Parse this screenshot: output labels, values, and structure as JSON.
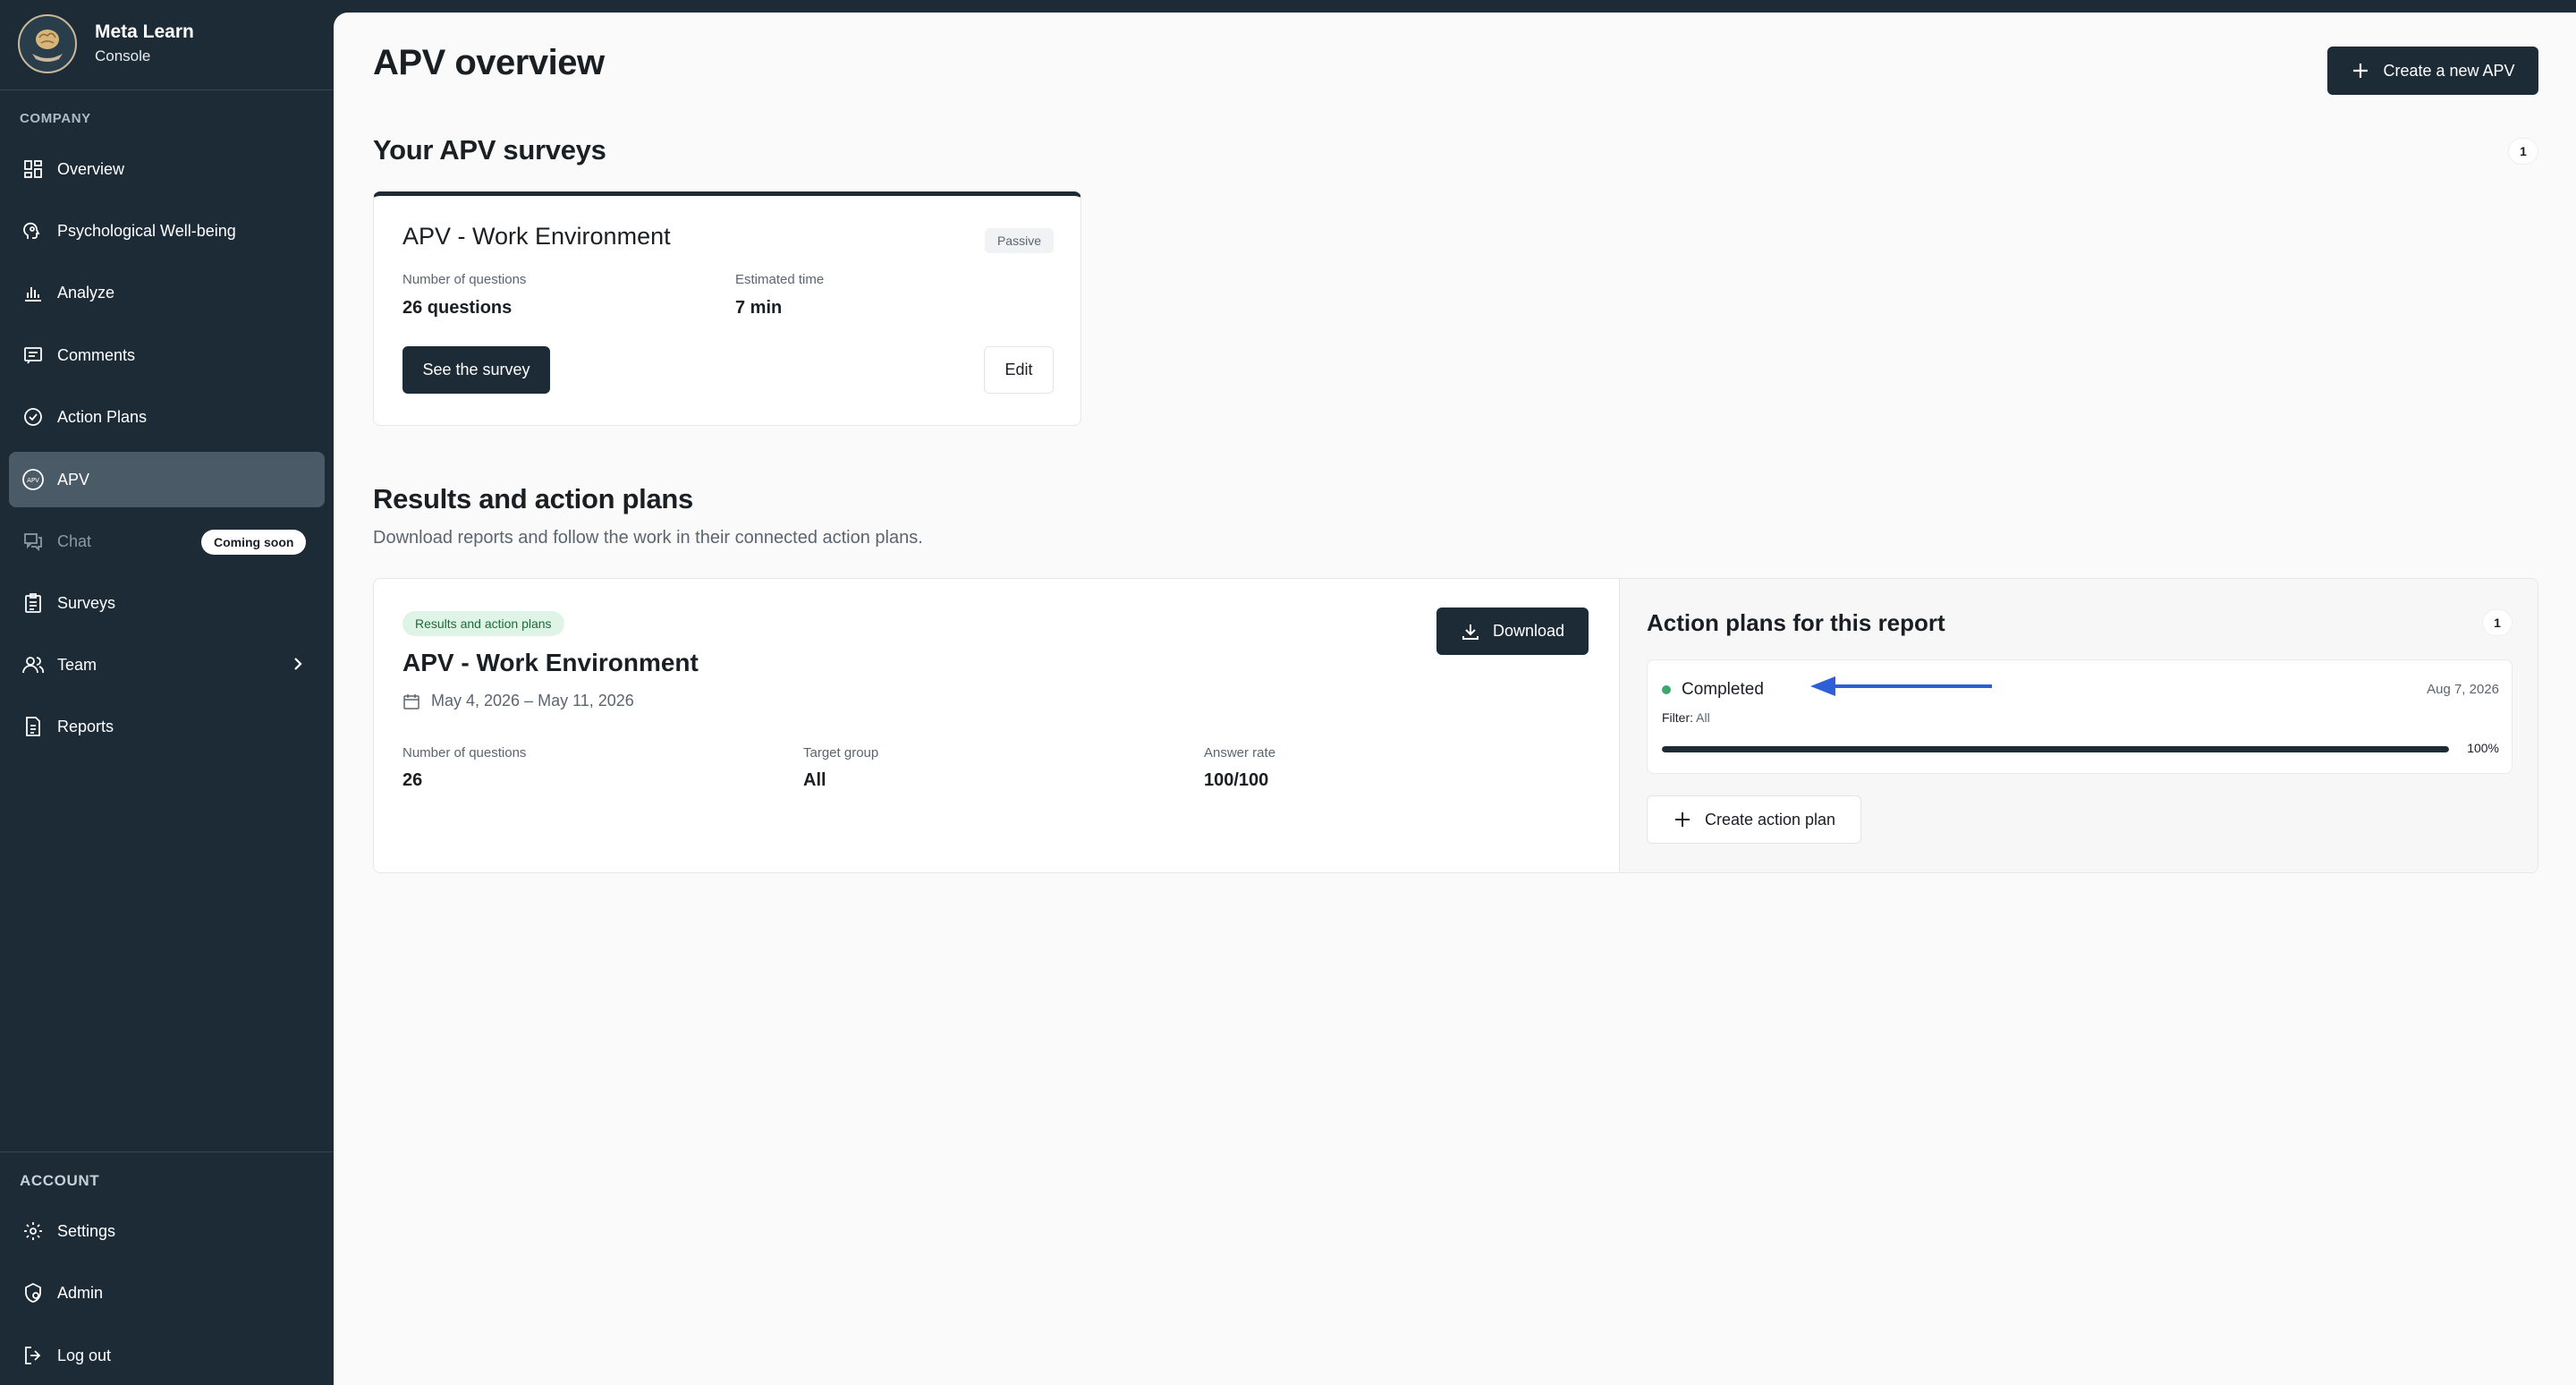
{
  "brand": {
    "name": "Meta Learn",
    "subtitle": "Console"
  },
  "sidebar": {
    "company_label": "COMPANY",
    "account_label": "ACCOUNT",
    "items": [
      {
        "label": "Overview",
        "icon": "dashboard-icon"
      },
      {
        "label": "Psychological Well-being",
        "icon": "head-icon"
      },
      {
        "label": "Analyze",
        "icon": "bar-chart-icon"
      },
      {
        "label": "Comments",
        "icon": "comment-icon"
      },
      {
        "label": "Action Plans",
        "icon": "check-circle-icon"
      },
      {
        "label": "APV",
        "icon": "apv-icon",
        "active": true
      },
      {
        "label": "Chat",
        "icon": "chat-icon",
        "badge": "Coming soon",
        "disabled": true
      },
      {
        "label": "Surveys",
        "icon": "clipboard-icon"
      },
      {
        "label": "Team",
        "icon": "users-icon",
        "has_submenu": true
      },
      {
        "label": "Reports",
        "icon": "document-icon"
      }
    ],
    "account_items": [
      {
        "label": "Settings",
        "icon": "gear-icon"
      },
      {
        "label": "Admin",
        "icon": "admin-icon"
      },
      {
        "label": "Log out",
        "icon": "logout-icon"
      }
    ]
  },
  "header": {
    "title": "APV overview",
    "create_button": "Create a new APV"
  },
  "surveys": {
    "heading": "Your APV surveys",
    "count": "1",
    "card": {
      "title": "APV - Work Environment",
      "status": "Passive",
      "questions_label": "Number of questions",
      "questions_value": "26 questions",
      "time_label": "Estimated time",
      "time_value": "7 min",
      "see_button": "See the survey",
      "edit_button": "Edit"
    }
  },
  "results": {
    "heading": "Results and action plans",
    "description": "Download reports and follow the work in their connected action plans.",
    "report": {
      "tag": "Results and action plans",
      "title": "APV - Work Environment",
      "date_range": "May 4, 2026 – May 11, 2026",
      "download_button": "Download",
      "questions_label": "Number of questions",
      "questions_value": "26",
      "target_label": "Target group",
      "target_value": "All",
      "answer_label": "Answer rate",
      "answer_value": "100/100"
    },
    "action_plans": {
      "heading": "Action plans for this report",
      "count": "1",
      "plan": {
        "status": "Completed",
        "status_color": "#3aa76d",
        "date": "Aug 7, 2026",
        "filter_label": "Filter:",
        "filter_value": "All",
        "progress_label": "100%",
        "progress": 1.0
      },
      "create_button": "Create action plan"
    }
  },
  "colors": {
    "sidebar_bg": "#1c2b36",
    "accent_dark": "#1c2b36",
    "annotation_arrow": "#2f5fd6"
  }
}
